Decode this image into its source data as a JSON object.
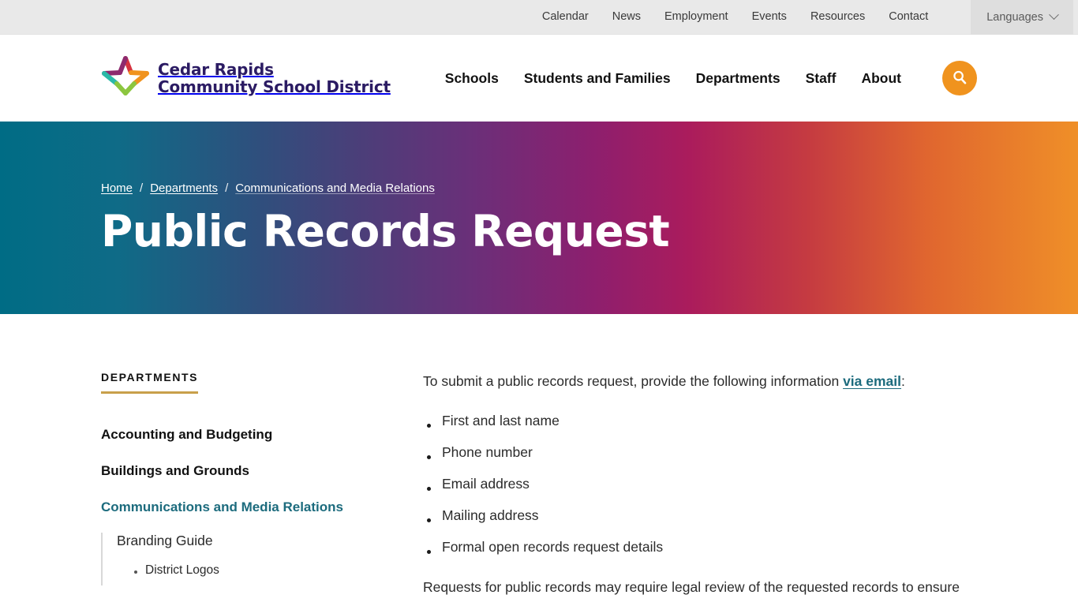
{
  "topbar": {
    "links": [
      {
        "label": "Calendar",
        "name": "calendar"
      },
      {
        "label": "News",
        "name": "news"
      },
      {
        "label": "Employment",
        "name": "employment"
      },
      {
        "label": "Events",
        "name": "events"
      },
      {
        "label": "Resources",
        "name": "resources"
      },
      {
        "label": "Contact",
        "name": "contact"
      }
    ],
    "languages_label": "Languages",
    "languages_icon": "chevron-down-icon"
  },
  "header": {
    "logo": {
      "icon": "five-point-star-logo",
      "line1": "Cedar Rapids",
      "line2": "Community School District",
      "text_color": "#2b1b63",
      "star_colors": {
        "upper_left": "#8e2a6e",
        "upper_right": "#d6333f",
        "right": "#f0931e",
        "lower_left": "#8cc63f",
        "left": "#2bb9a8"
      }
    },
    "nav": [
      {
        "label": "Schools",
        "name": "schools"
      },
      {
        "label": "Students and Families",
        "name": "students-and-families"
      },
      {
        "label": "Departments",
        "name": "departments"
      },
      {
        "label": "Staff",
        "name": "staff"
      },
      {
        "label": "About",
        "name": "about"
      }
    ],
    "search_icon": "search-icon",
    "search_color": "#f0931e"
  },
  "hero": {
    "breadcrumb": [
      {
        "label": "Home",
        "current": false
      },
      {
        "label": "Departments",
        "current": false
      },
      {
        "label": "Communications and Media Relations",
        "current": true
      }
    ],
    "separator": "/",
    "title": "Public Records Request",
    "gradient_from": "#006c85",
    "gradient_mid": "#8d1f6e",
    "gradient_to": "#ef8f28"
  },
  "sidebar": {
    "heading": "DEPARTMENTS",
    "underline_color": "#c8a04b",
    "active_color": "#1c6b7d",
    "items": [
      {
        "label": "Accounting and Budgeting",
        "active": false
      },
      {
        "label": "Buildings and Grounds",
        "active": false
      },
      {
        "label": "Communications and Media Relations",
        "active": true
      }
    ],
    "subitems": [
      {
        "label": "Branding Guide"
      }
    ],
    "subsubitems": [
      {
        "label": "District Logos"
      }
    ]
  },
  "main": {
    "lede_before": "To submit a public records request, provide the following information ",
    "lede_link": "via email",
    "lede_after": ":",
    "requirements": [
      "First and last name",
      "Phone number",
      "Email address",
      "Mailing address",
      "Formal open records request details"
    ],
    "paragraph": "Requests for public records may require legal review of the requested records to ensure"
  }
}
